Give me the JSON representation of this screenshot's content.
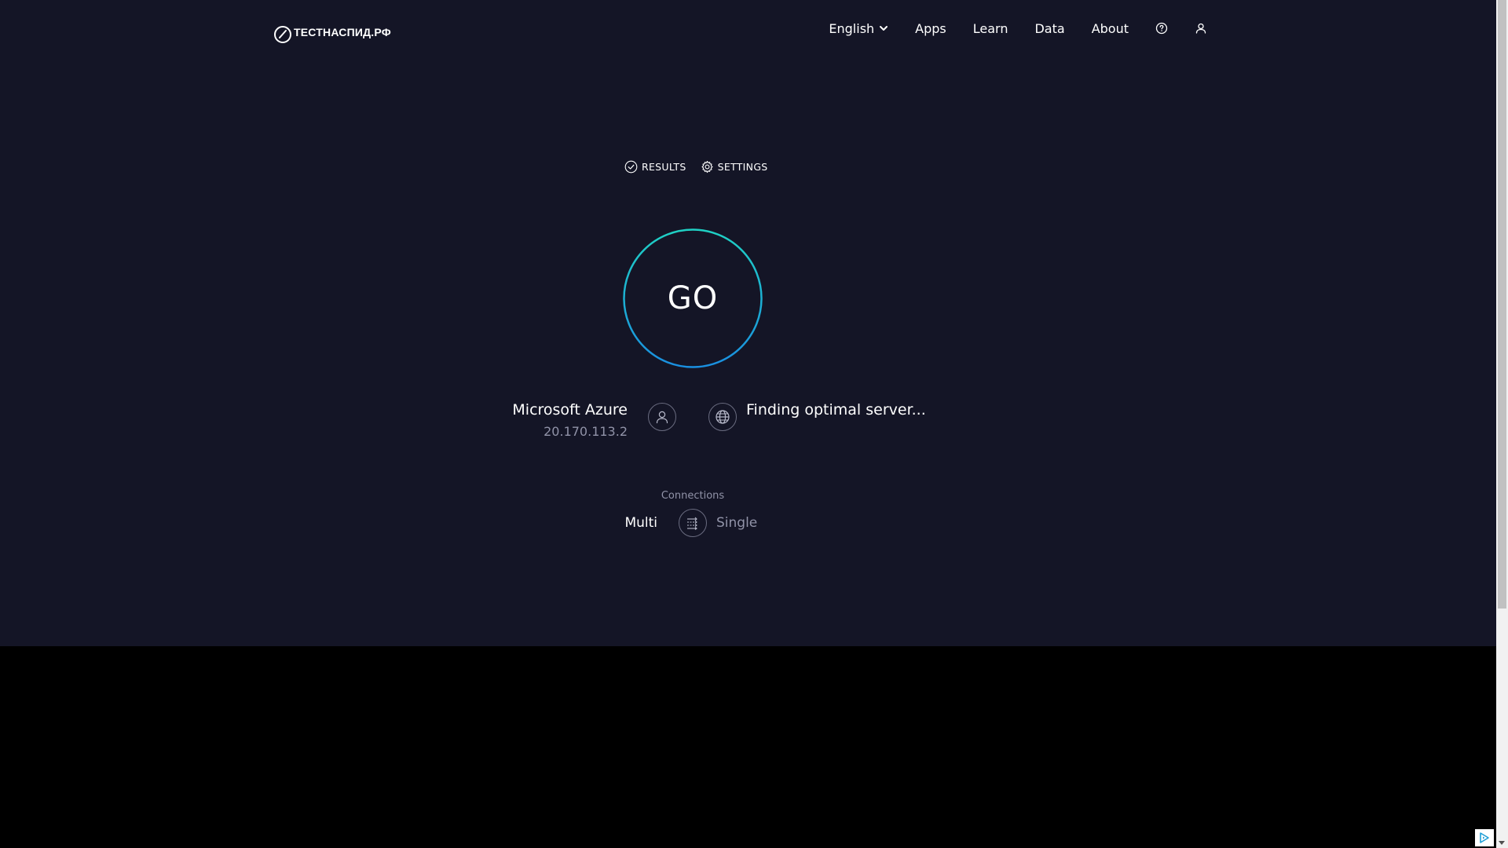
{
  "header": {
    "logo_text": "ТЕСТНАСПИД.РФ",
    "nav": {
      "language": "English",
      "apps": "Apps",
      "learn": "Learn",
      "data": "Data",
      "about": "About"
    }
  },
  "tabs": {
    "results": "RESULTS",
    "settings": "SETTINGS"
  },
  "go_button": {
    "label": "GO"
  },
  "isp": {
    "name": "Microsoft Azure",
    "ip": "20.170.113.2"
  },
  "server": {
    "status": "Finding optimal server..."
  },
  "connections": {
    "label": "Connections",
    "multi": "Multi",
    "single": "Single",
    "selected": "Multi"
  },
  "colors": {
    "background": "#141526",
    "ring_start": "#1fd1c4",
    "ring_end": "#1a8fe0",
    "muted_text": "#9193a8"
  },
  "icons": {
    "logo": "speedometer-icon",
    "help": "question-circle-icon",
    "account": "user-icon",
    "results": "check-circle-icon",
    "settings": "gear-icon",
    "isp": "user-icon",
    "server": "globe-icon",
    "connections": "arrows-icon",
    "ad": "adchoices-icon"
  }
}
